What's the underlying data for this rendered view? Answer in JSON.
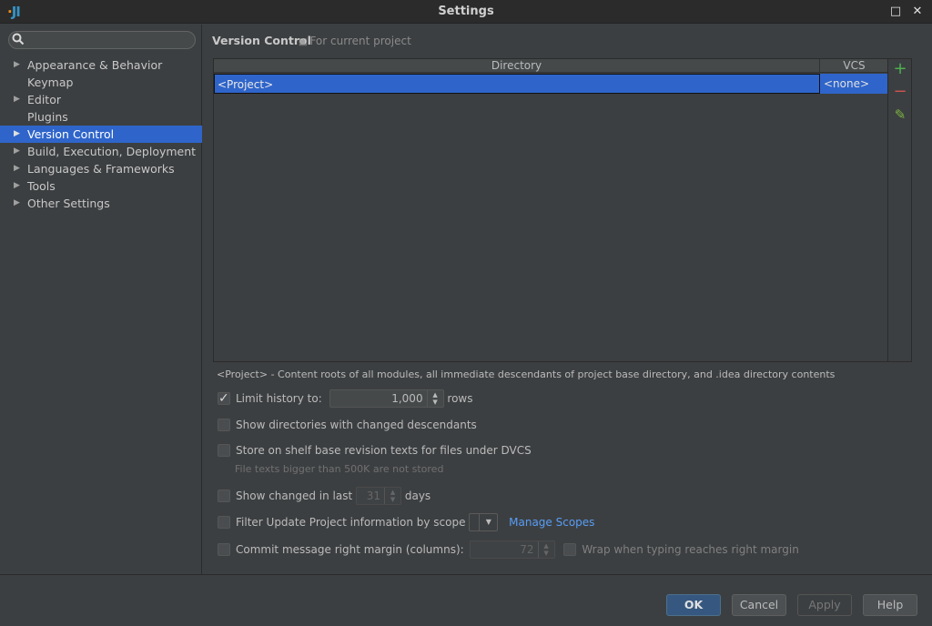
{
  "window": {
    "title": "Settings",
    "logo": "JI",
    "maximize_icon": "□",
    "close_icon": "✕"
  },
  "sidebar": {
    "search": {
      "placeholder": "",
      "value": "",
      "icon": "🔍"
    },
    "items": [
      {
        "label": "Appearance & Behavior",
        "expandable": true,
        "selected": false
      },
      {
        "label": "Keymap",
        "expandable": false,
        "selected": false
      },
      {
        "label": "Editor",
        "expandable": true,
        "selected": false
      },
      {
        "label": "Plugins",
        "expandable": false,
        "selected": false
      },
      {
        "label": "Version Control",
        "expandable": true,
        "selected": true
      },
      {
        "label": "Build, Execution, Deployment",
        "expandable": true,
        "selected": false
      },
      {
        "label": "Languages & Frameworks",
        "expandable": true,
        "selected": false
      },
      {
        "label": "Tools",
        "expandable": true,
        "selected": false
      },
      {
        "label": "Other Settings",
        "expandable": true,
        "selected": false
      }
    ]
  },
  "header": {
    "breadcrumb": "Version Control",
    "scope_label": "For current project"
  },
  "table": {
    "columns": [
      "Directory",
      "VCS"
    ],
    "rows": [
      {
        "directory": "<Project>",
        "vcs": "<none>"
      }
    ]
  },
  "toolbar": {
    "add": "+",
    "remove": "−",
    "edit": "✎"
  },
  "note": "<Project> - Content roots of all modules, all immediate descendants of project base directory, and .idea directory contents",
  "options": {
    "limit_history": {
      "label": "Limit history to:",
      "checked": true,
      "value": "1,000",
      "suffix": "rows"
    },
    "show_dirs": {
      "label": "Show directories with changed descendants",
      "checked": false
    },
    "store_shelf": {
      "label": "Store on shelf base revision texts for files under DVCS",
      "checked": false,
      "hint": "File texts bigger than 500K are not stored"
    },
    "show_changed": {
      "label": "Show changed in last",
      "checked": false,
      "value": "31",
      "suffix": "days"
    },
    "filter_update": {
      "label": "Filter Update Project information by scope",
      "checked": false,
      "selected": "",
      "link": "Manage Scopes"
    },
    "commit_margin": {
      "label": "Commit message right margin (columns):",
      "checked": false,
      "value": "72"
    },
    "wrap_typing": {
      "label": "Wrap when typing reaches right margin",
      "checked": false
    }
  },
  "buttons": {
    "ok": "OK",
    "cancel": "Cancel",
    "apply": "Apply",
    "help": "Help"
  },
  "colors": {
    "accent": "#2f65ca",
    "add": "#4caf50",
    "remove": "#c75450",
    "edit": "#7cb342",
    "link": "#589df6"
  }
}
